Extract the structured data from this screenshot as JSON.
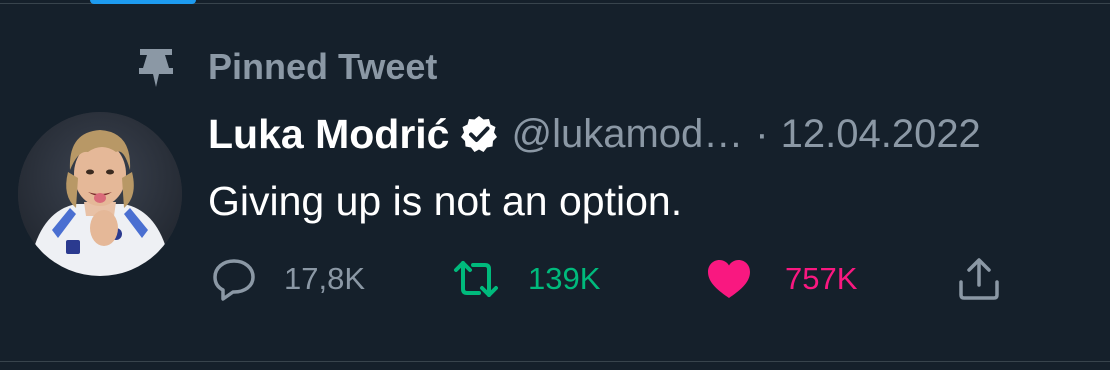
{
  "pinned": {
    "label": "Pinned Tweet",
    "icon": "pin-icon"
  },
  "author": {
    "display_name": "Luka Modrić",
    "handle": "@lukamod…",
    "verified_icon": "verified-badge-icon",
    "avatar": "avatar-photo"
  },
  "tweet": {
    "separator": "·",
    "date": "12.04.2022",
    "text": "Giving up is not an option."
  },
  "actions": {
    "reply": {
      "icon": "reply-icon",
      "count": "17,8K",
      "color": "#8b98a5"
    },
    "retweet": {
      "icon": "retweet-icon",
      "count": "139K",
      "color": "#00ba7c"
    },
    "like": {
      "icon": "heart-icon",
      "count": "757K",
      "color": "#f91880"
    },
    "share": {
      "icon": "share-icon"
    }
  },
  "colors": {
    "background": "#15202b",
    "secondary_text": "#8b98a5",
    "primary_text": "#ffffff",
    "accent": "#1d9bf0"
  }
}
